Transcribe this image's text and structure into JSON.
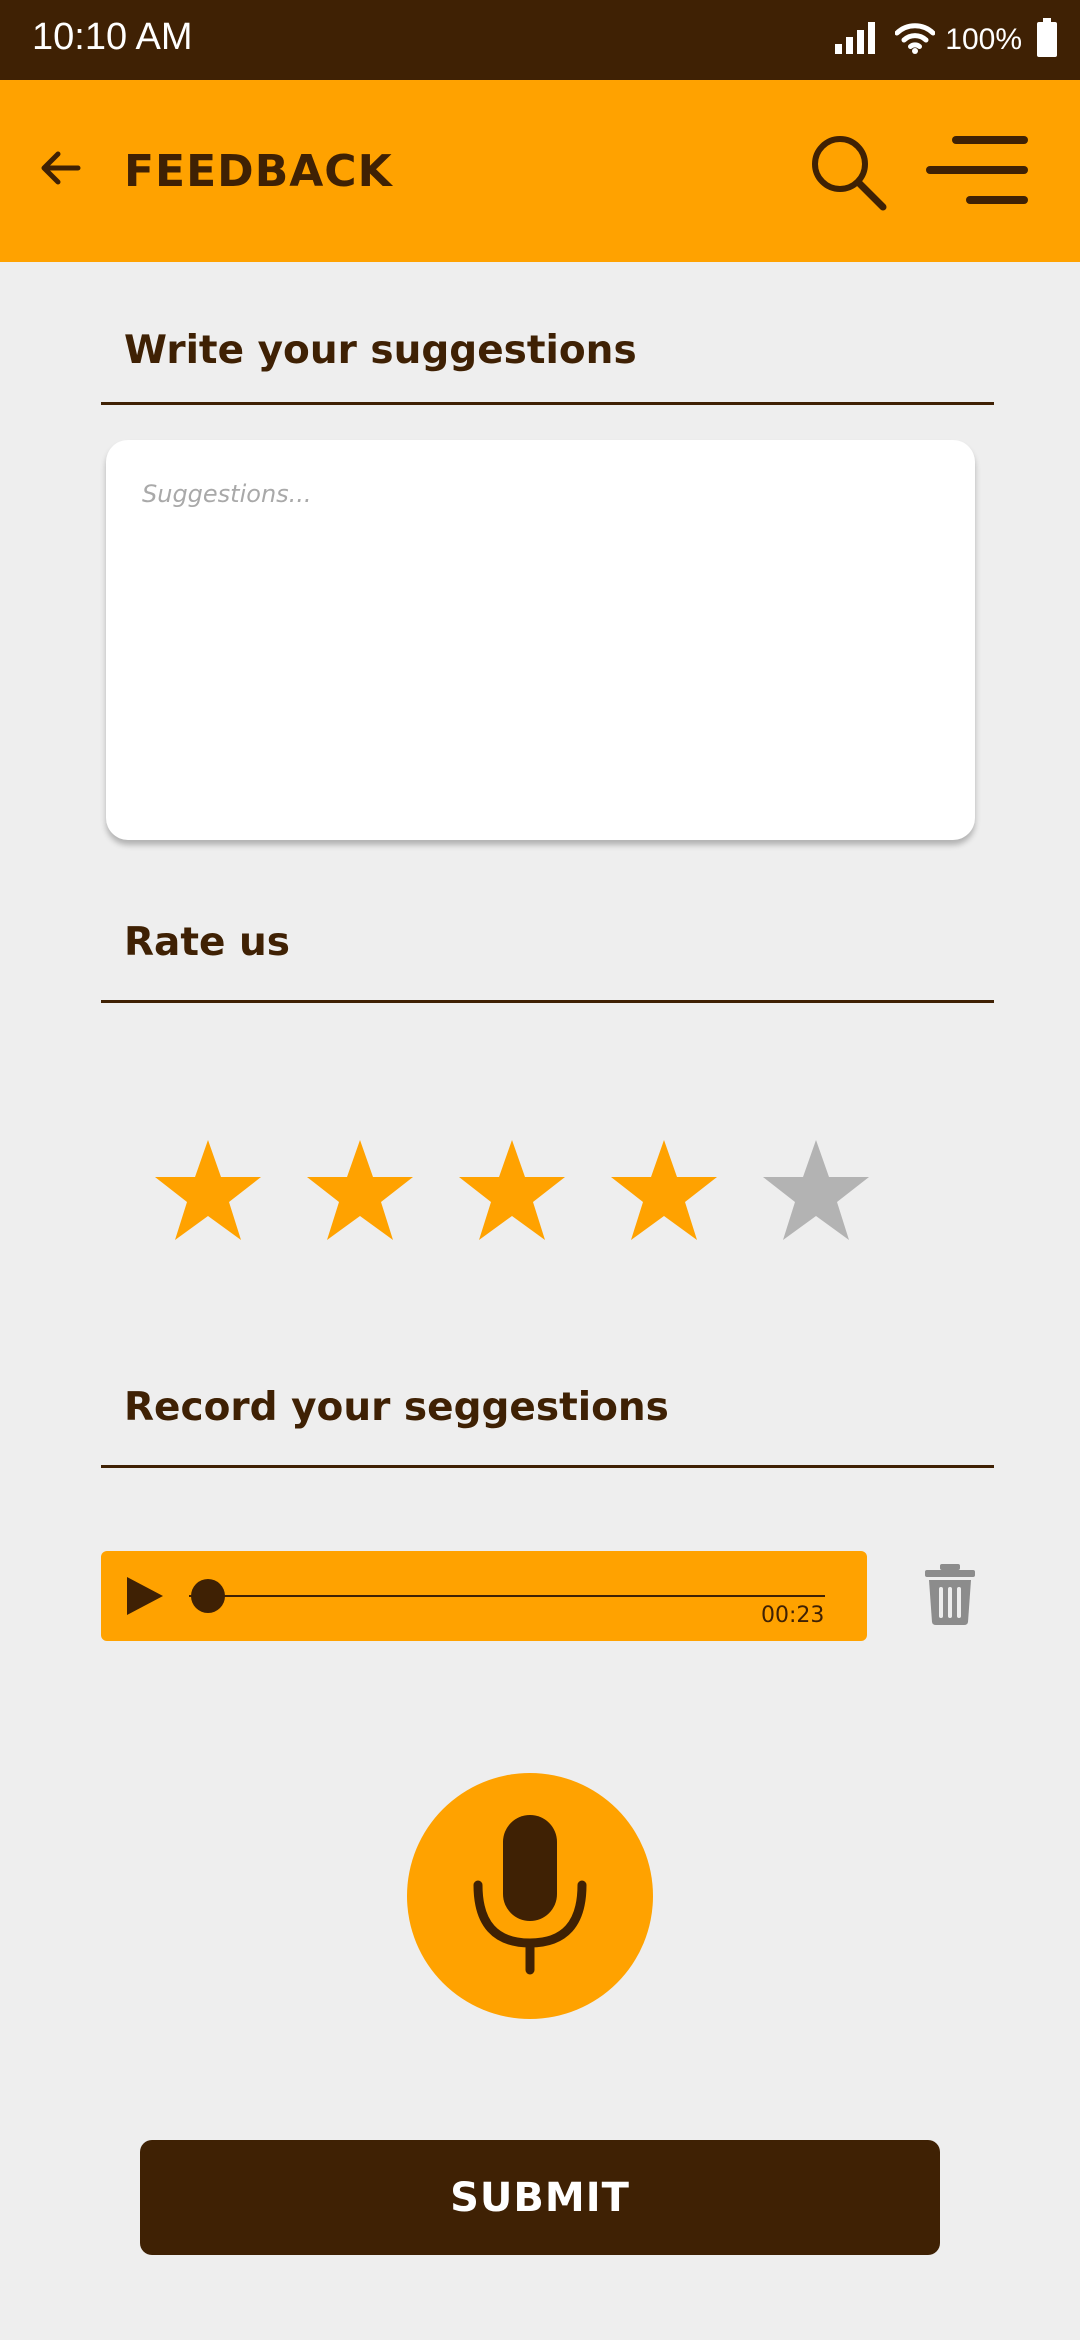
{
  "status_bar": {
    "time": "10:10 AM",
    "battery": "100%",
    "icons": [
      "signal-icon",
      "wifi-icon",
      "battery-icon"
    ]
  },
  "app_bar": {
    "title": "FEEDBACK",
    "icons": [
      "back-arrow-icon",
      "search-icon",
      "menu-icon"
    ]
  },
  "suggestions": {
    "heading": "Write your suggestions",
    "placeholder": "Suggestions...",
    "value": ""
  },
  "rating": {
    "heading": "Rate us",
    "value": 4,
    "max": 5
  },
  "recording": {
    "heading": "Record your seggestions",
    "duration": "00:23",
    "progress": 0.03,
    "icons": [
      "play-icon",
      "trash-icon",
      "microphone-icon"
    ]
  },
  "submit": {
    "label": "SUBMIT"
  },
  "colors": {
    "primary": "#ffa200",
    "dark": "#3f2104",
    "background": "#eeeeee",
    "star_inactive": "#b3b3b3",
    "trash": "#8c8c8c"
  }
}
